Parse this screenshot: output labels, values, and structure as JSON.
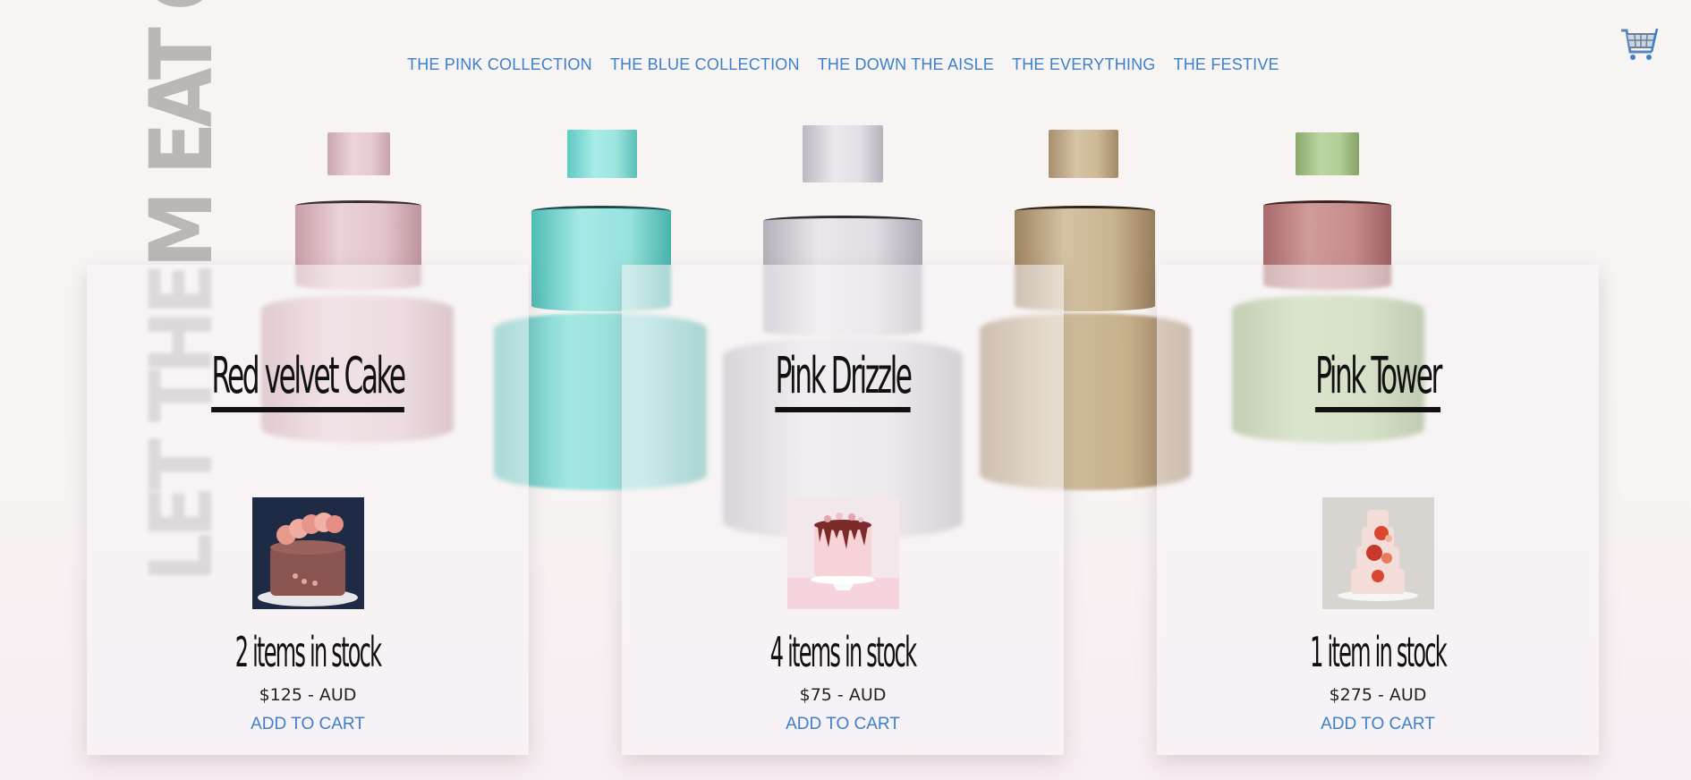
{
  "brand": {
    "logo_text": "LET THEM EAT CAKE"
  },
  "nav": {
    "items": [
      {
        "label": "THE PINK COLLECTION"
      },
      {
        "label": "THE BLUE COLLECTION"
      },
      {
        "label": "THE DOWN THE AISLE"
      },
      {
        "label": "THE EVERYTHING"
      },
      {
        "label": "THE FESTIVE"
      }
    ]
  },
  "cart": {
    "icon": "shopping-cart-icon"
  },
  "colors": {
    "accent": "#3d7fcc",
    "cake_pink": "#e8c9cf",
    "cake_teal": "#8ee0dc",
    "cake_lilac": "#dcd8df",
    "cake_tan": "#c9b08e",
    "cake_mauve": "#c98686",
    "cake_green": "#a9c88a"
  },
  "products": [
    {
      "title": "Red velvet Cake",
      "stock": "2 items in stock",
      "price": "$125 - AUD",
      "cta": "ADD TO CART"
    },
    {
      "title": "Pink Drizzle",
      "stock": "4 items in stock",
      "price": "$75 - AUD",
      "cta": "ADD TO CART"
    },
    {
      "title": "Pink Tower",
      "stock": "1 item in stock",
      "price": "$275 - AUD",
      "cta": "ADD TO CART"
    }
  ]
}
